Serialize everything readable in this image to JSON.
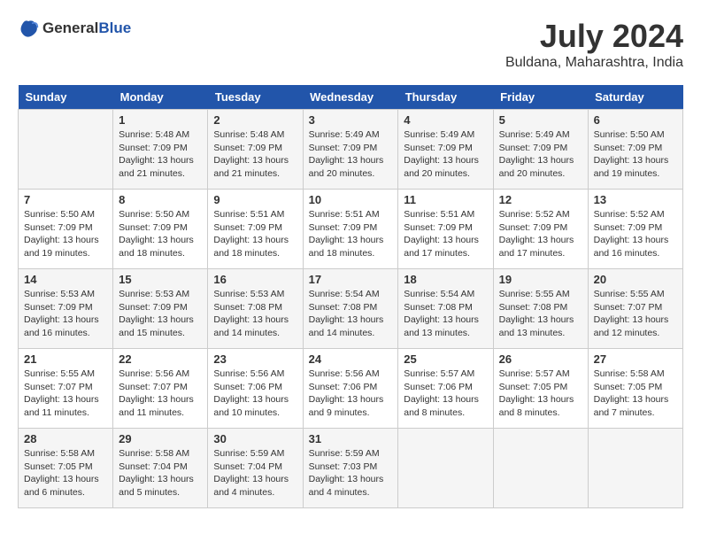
{
  "header": {
    "logo_general": "General",
    "logo_blue": "Blue",
    "month_year": "July 2024",
    "location": "Buldana, Maharashtra, India"
  },
  "calendar": {
    "days_of_week": [
      "Sunday",
      "Monday",
      "Tuesday",
      "Wednesday",
      "Thursday",
      "Friday",
      "Saturday"
    ],
    "weeks": [
      [
        {
          "day": "",
          "info": ""
        },
        {
          "day": "1",
          "info": "Sunrise: 5:48 AM\nSunset: 7:09 PM\nDaylight: 13 hours\nand 21 minutes."
        },
        {
          "day": "2",
          "info": "Sunrise: 5:48 AM\nSunset: 7:09 PM\nDaylight: 13 hours\nand 21 minutes."
        },
        {
          "day": "3",
          "info": "Sunrise: 5:49 AM\nSunset: 7:09 PM\nDaylight: 13 hours\nand 20 minutes."
        },
        {
          "day": "4",
          "info": "Sunrise: 5:49 AM\nSunset: 7:09 PM\nDaylight: 13 hours\nand 20 minutes."
        },
        {
          "day": "5",
          "info": "Sunrise: 5:49 AM\nSunset: 7:09 PM\nDaylight: 13 hours\nand 20 minutes."
        },
        {
          "day": "6",
          "info": "Sunrise: 5:50 AM\nSunset: 7:09 PM\nDaylight: 13 hours\nand 19 minutes."
        }
      ],
      [
        {
          "day": "7",
          "info": "Sunrise: 5:50 AM\nSunset: 7:09 PM\nDaylight: 13 hours\nand 19 minutes."
        },
        {
          "day": "8",
          "info": "Sunrise: 5:50 AM\nSunset: 7:09 PM\nDaylight: 13 hours\nand 18 minutes."
        },
        {
          "day": "9",
          "info": "Sunrise: 5:51 AM\nSunset: 7:09 PM\nDaylight: 13 hours\nand 18 minutes."
        },
        {
          "day": "10",
          "info": "Sunrise: 5:51 AM\nSunset: 7:09 PM\nDaylight: 13 hours\nand 18 minutes."
        },
        {
          "day": "11",
          "info": "Sunrise: 5:51 AM\nSunset: 7:09 PM\nDaylight: 13 hours\nand 17 minutes."
        },
        {
          "day": "12",
          "info": "Sunrise: 5:52 AM\nSunset: 7:09 PM\nDaylight: 13 hours\nand 17 minutes."
        },
        {
          "day": "13",
          "info": "Sunrise: 5:52 AM\nSunset: 7:09 PM\nDaylight: 13 hours\nand 16 minutes."
        }
      ],
      [
        {
          "day": "14",
          "info": "Sunrise: 5:53 AM\nSunset: 7:09 PM\nDaylight: 13 hours\nand 16 minutes."
        },
        {
          "day": "15",
          "info": "Sunrise: 5:53 AM\nSunset: 7:09 PM\nDaylight: 13 hours\nand 15 minutes."
        },
        {
          "day": "16",
          "info": "Sunrise: 5:53 AM\nSunset: 7:08 PM\nDaylight: 13 hours\nand 14 minutes."
        },
        {
          "day": "17",
          "info": "Sunrise: 5:54 AM\nSunset: 7:08 PM\nDaylight: 13 hours\nand 14 minutes."
        },
        {
          "day": "18",
          "info": "Sunrise: 5:54 AM\nSunset: 7:08 PM\nDaylight: 13 hours\nand 13 minutes."
        },
        {
          "day": "19",
          "info": "Sunrise: 5:55 AM\nSunset: 7:08 PM\nDaylight: 13 hours\nand 13 minutes."
        },
        {
          "day": "20",
          "info": "Sunrise: 5:55 AM\nSunset: 7:07 PM\nDaylight: 13 hours\nand 12 minutes."
        }
      ],
      [
        {
          "day": "21",
          "info": "Sunrise: 5:55 AM\nSunset: 7:07 PM\nDaylight: 13 hours\nand 11 minutes."
        },
        {
          "day": "22",
          "info": "Sunrise: 5:56 AM\nSunset: 7:07 PM\nDaylight: 13 hours\nand 11 minutes."
        },
        {
          "day": "23",
          "info": "Sunrise: 5:56 AM\nSunset: 7:06 PM\nDaylight: 13 hours\nand 10 minutes."
        },
        {
          "day": "24",
          "info": "Sunrise: 5:56 AM\nSunset: 7:06 PM\nDaylight: 13 hours\nand 9 minutes."
        },
        {
          "day": "25",
          "info": "Sunrise: 5:57 AM\nSunset: 7:06 PM\nDaylight: 13 hours\nand 8 minutes."
        },
        {
          "day": "26",
          "info": "Sunrise: 5:57 AM\nSunset: 7:05 PM\nDaylight: 13 hours\nand 8 minutes."
        },
        {
          "day": "27",
          "info": "Sunrise: 5:58 AM\nSunset: 7:05 PM\nDaylight: 13 hours\nand 7 minutes."
        }
      ],
      [
        {
          "day": "28",
          "info": "Sunrise: 5:58 AM\nSunset: 7:05 PM\nDaylight: 13 hours\nand 6 minutes."
        },
        {
          "day": "29",
          "info": "Sunrise: 5:58 AM\nSunset: 7:04 PM\nDaylight: 13 hours\nand 5 minutes."
        },
        {
          "day": "30",
          "info": "Sunrise: 5:59 AM\nSunset: 7:04 PM\nDaylight: 13 hours\nand 4 minutes."
        },
        {
          "day": "31",
          "info": "Sunrise: 5:59 AM\nSunset: 7:03 PM\nDaylight: 13 hours\nand 4 minutes."
        },
        {
          "day": "",
          "info": ""
        },
        {
          "day": "",
          "info": ""
        },
        {
          "day": "",
          "info": ""
        }
      ]
    ]
  }
}
